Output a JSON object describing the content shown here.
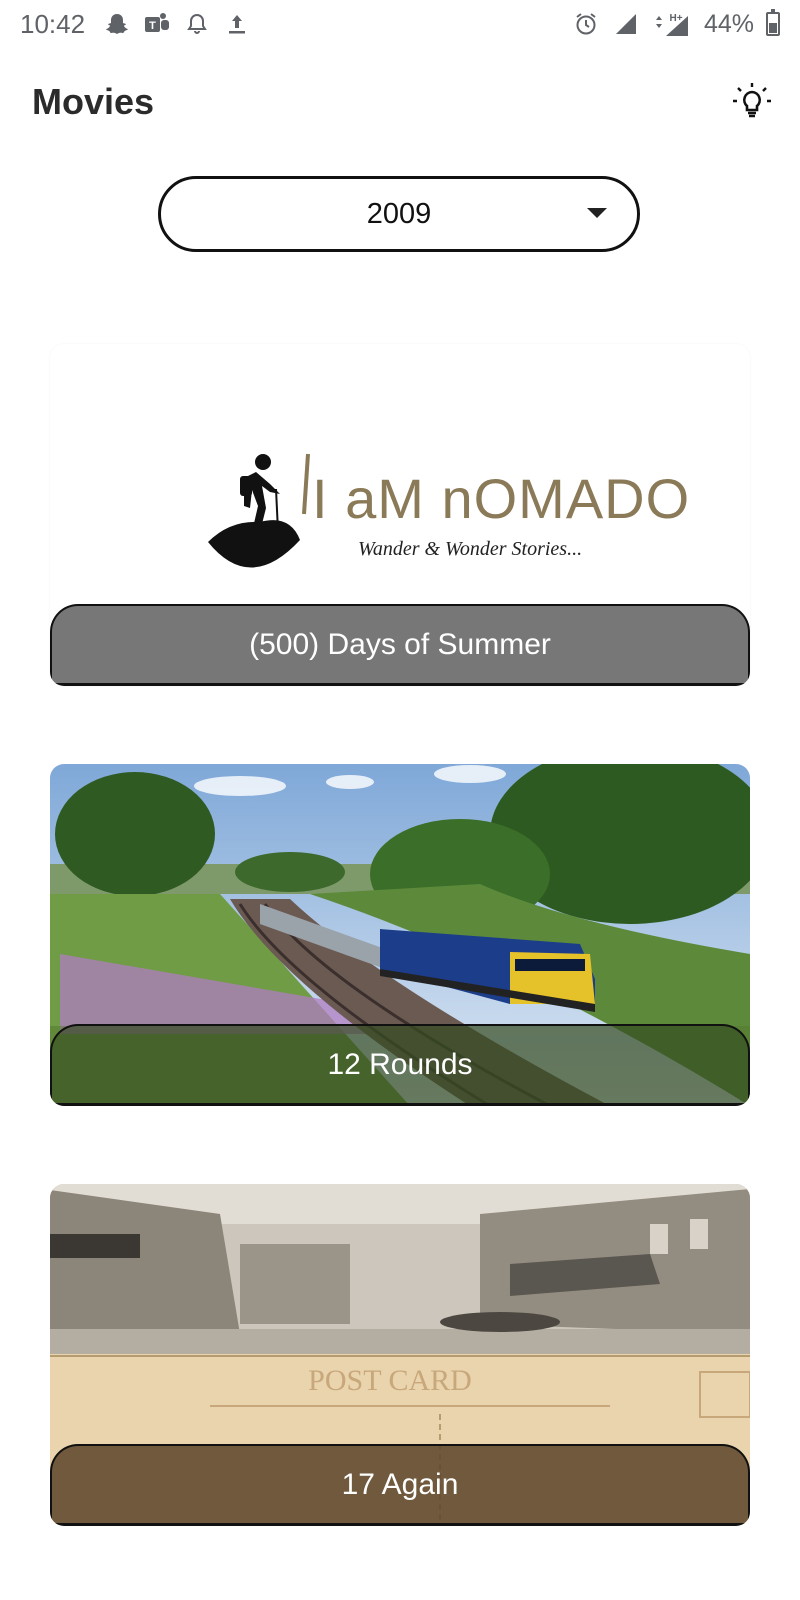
{
  "status_bar": {
    "time": "10:42",
    "left_icons": [
      "snapchat-icon",
      "teams-icon",
      "notification-bell-icon",
      "upload-icon"
    ],
    "right_icons": [
      "alarm-icon",
      "signal-icon",
      "network-type-hplus-icon",
      "signal-icon-2"
    ],
    "network_label": "H+",
    "battery": "44%"
  },
  "app_bar": {
    "title": "Movies",
    "action_icon": "lightbulb-icon"
  },
  "year_filter": {
    "selected": "2009"
  },
  "movies": [
    {
      "title": "(500) Days of Summer",
      "image": "i-am-nomado-logo",
      "logo_title": "I aM nOMADO",
      "logo_tagline": "Wander & Wonder Stories..."
    },
    {
      "title": "12 Rounds",
      "image": "train-landscape-photo"
    },
    {
      "title": "17 Again",
      "image": "vintage-postcard-photo"
    }
  ],
  "colors": {
    "caption_gray": "#777777",
    "logo_gold": "#8a7a58",
    "outline": "#111111"
  }
}
